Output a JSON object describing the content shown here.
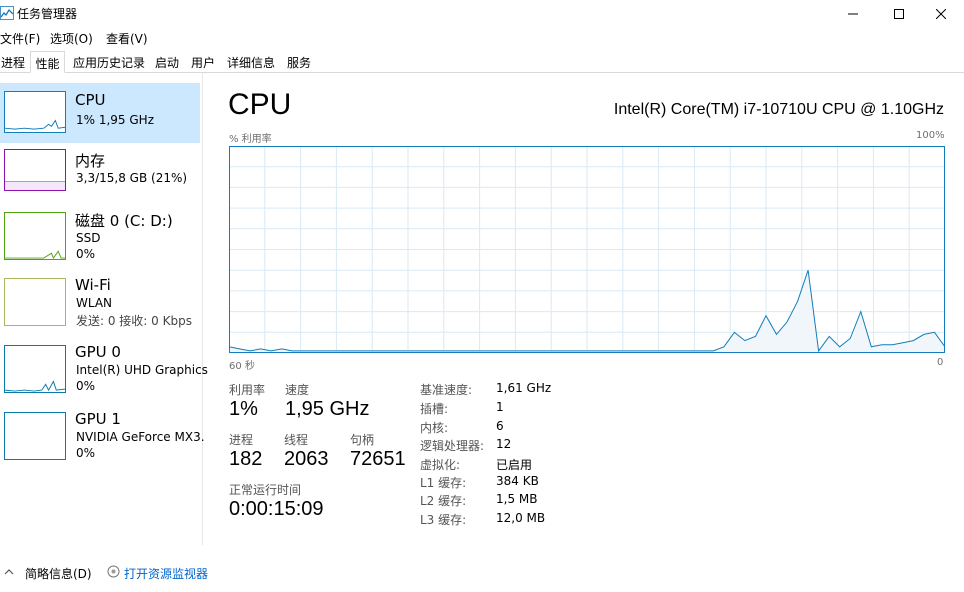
{
  "window": {
    "title": "任务管理器"
  },
  "menu": [
    "文件(F)",
    "选项(O)",
    "查看(V)"
  ],
  "tabs": [
    "进程",
    "性能",
    "应用历史记录",
    "启动",
    "用户",
    "详细信息",
    "服务"
  ],
  "sidebar": [
    {
      "name": "CPU",
      "line1": "1% 1,95 GHz",
      "line2": "",
      "selected": true,
      "color": "#117dbb"
    },
    {
      "name": "内存",
      "line1": "3,3/15,8 GB (21%)",
      "line2": "",
      "color": "#8b12ae"
    },
    {
      "name": "磁盘 0 (C: D:)",
      "line1": "SSD",
      "line2": "0%",
      "color": "#4da60c"
    },
    {
      "name": "Wi-Fi",
      "line1": "WLAN",
      "line2": "发送: 0 接收: 0 Kbps",
      "color": "#a74f01"
    },
    {
      "name": "GPU 0",
      "line1": "Intel(R) UHD Graphics",
      "line2": "0%",
      "color": "#0a7ba8"
    },
    {
      "name": "GPU 1",
      "line1": "NVIDIA GeForce MX3.",
      "line2": "0%",
      "color": "#0a7ba8"
    }
  ],
  "main": {
    "title": "CPU",
    "model": "Intel(R) Core(TM) i7-10710U CPU @ 1.10GHz",
    "util_label": "% 利用率",
    "max_label": "100%",
    "time_label": "60 秒",
    "zero_label": "0"
  },
  "stats": {
    "util_label": "利用率",
    "util_value": "1%",
    "speed_label": "速度",
    "speed_value": "1,95 GHz",
    "proc_label": "进程",
    "proc_value": "182",
    "thread_label": "线程",
    "thread_value": "2063",
    "handle_label": "句柄",
    "handle_value": "72651",
    "uptime_label": "正常运行时间",
    "uptime_value": "0:00:15:09"
  },
  "specs": [
    {
      "label": "基准速度:",
      "value": "1,61 GHz"
    },
    {
      "label": "插槽:",
      "value": "1"
    },
    {
      "label": "内核:",
      "value": "6"
    },
    {
      "label": "逻辑处理器:",
      "value": "12"
    },
    {
      "label": "虚拟化:",
      "value": "已启用"
    },
    {
      "label": "L1 缓存:",
      "value": "384 KB"
    },
    {
      "label": "L2 缓存:",
      "value": "1,5 MB"
    },
    {
      "label": "L3 缓存:",
      "value": "12,0 MB"
    }
  ],
  "bottom": {
    "fewer": "简略信息(D)",
    "monitor": "打开资源监视器"
  },
  "cpu_history": [
    3,
    2,
    1,
    2,
    1,
    2,
    1,
    1,
    1,
    1,
    1,
    1,
    1,
    1,
    1,
    1,
    1,
    1,
    1,
    1,
    1,
    1,
    1,
    1,
    1,
    1,
    1,
    1,
    1,
    1,
    1,
    1,
    1,
    1,
    1,
    1,
    1,
    1,
    1,
    1,
    1,
    1,
    1,
    1,
    1,
    1,
    1,
    3,
    10,
    6,
    8,
    18,
    9,
    15,
    25,
    40,
    1,
    8,
    3,
    7,
    20,
    3,
    4,
    4,
    5,
    6,
    9,
    10,
    3
  ],
  "colors": {
    "accent": "#117dbb",
    "graph_fill": "#f1f6fa",
    "grid": "#d9eaf4",
    "selected": "#cce8ff"
  }
}
